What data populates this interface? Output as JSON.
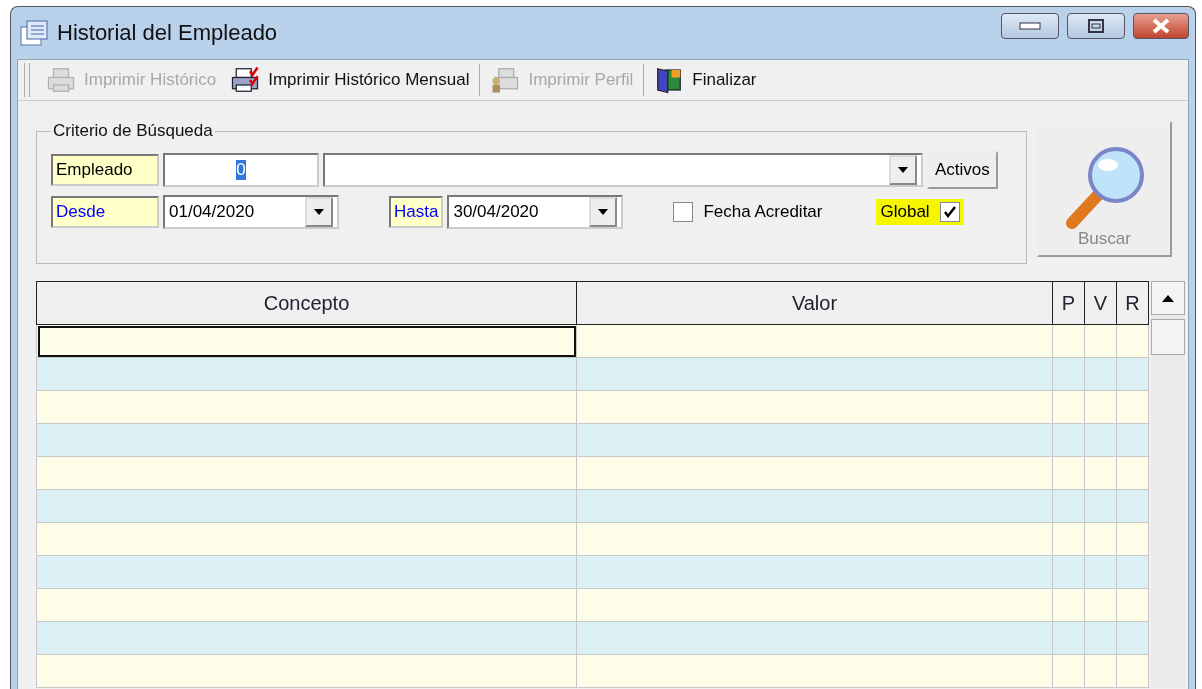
{
  "window": {
    "title": "Historial del Empleado"
  },
  "toolbar": [
    {
      "label": "Imprimir Histórico",
      "disabled": true,
      "kind": "printer"
    },
    {
      "label": "Imprimir Histórico Mensual",
      "disabled": false,
      "kind": "printer-check"
    },
    {
      "label": "Imprimir Perfil",
      "disabled": true,
      "kind": "printer-person"
    },
    {
      "label": "Finalizar",
      "disabled": false,
      "kind": "exit"
    }
  ],
  "criteria": {
    "title": "Criterio de Búsqueda",
    "employee": {
      "label": "Empleado",
      "value": "0",
      "value_selected": true
    },
    "active_button": "Activos",
    "from": {
      "label": "Desde",
      "value": "01/04/2020"
    },
    "to": {
      "label": "Hasta",
      "value": "30/04/2020"
    },
    "fecha_acreditar": {
      "label": "Fecha Acreditar",
      "checked": false
    },
    "global": {
      "label": "Global",
      "checked": true,
      "highlighted": true
    }
  },
  "search_button": {
    "label": "Buscar",
    "disabled": true
  },
  "table": {
    "columns": [
      "Concepto",
      "Valor",
      "P",
      "V",
      "R"
    ],
    "rows": [
      {
        "selected": true
      },
      {
        "selected": false
      },
      {
        "selected": false
      },
      {
        "selected": false
      },
      {
        "selected": false
      },
      {
        "selected": false
      },
      {
        "selected": false
      },
      {
        "selected": false
      },
      {
        "selected": false
      },
      {
        "selected": false
      },
      {
        "selected": false
      }
    ]
  }
}
